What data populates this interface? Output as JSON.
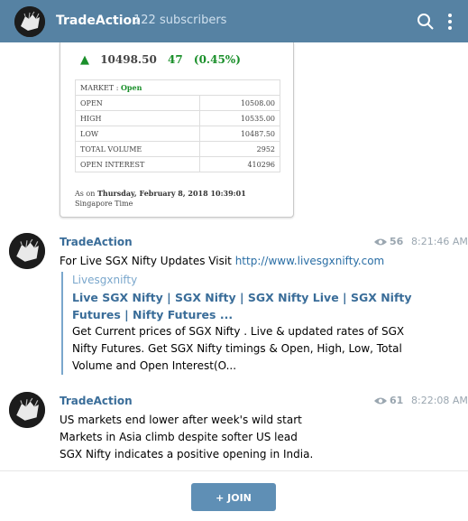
{
  "header": {
    "channel_name": "TradeAction",
    "subscribers": "122 subscribers",
    "icons": {
      "search": "search-icon",
      "menu": "more-vertical-icon"
    }
  },
  "widget": {
    "price": "10498.50",
    "change": "47",
    "change_pct": "(0.45%)",
    "market_label": "MARKET : ",
    "market_state": "Open",
    "rows": [
      {
        "label": "OPEN",
        "value": "10508.00"
      },
      {
        "label": "HIGH",
        "value": "10535.00"
      },
      {
        "label": "LOW",
        "value": "10487.50"
      },
      {
        "label": "TOTAL VOLUME",
        "value": "2952"
      },
      {
        "label": "OPEN INTEREST",
        "value": "410296"
      }
    ],
    "asof_prefix": "As on ",
    "asof_date": "Thursday, February 8, 2018 10:39:01",
    "asof_suffix": " Singapore Time",
    "colors": {
      "up": "#1a8f2a"
    }
  },
  "messages": [
    {
      "author": "TradeAction",
      "views": "56",
      "time": "8:21:46 AM",
      "text_prefix": "For Live SGX Nifty Updates Visit ",
      "link": "http://www.livesgxnifty.com",
      "preview": {
        "site": "Livesgxnifty",
        "title": "Live SGX Nifty | SGX Nifty | SGX Nifty Live | SGX Nifty Futures | Nifty Futures ...",
        "description": "Get Current prices of SGX Nifty . Live & updated rates of SGX Nifty Futures. Get SGX Nifty timings & Open, High, Low, Total Volume and Open Interest(O..."
      }
    },
    {
      "author": "TradeAction",
      "views": "61",
      "time": "8:22:08 AM",
      "lines": [
        "US markets end lower after week's wild start",
        "Markets in Asia climb despite softer US lead",
        "SGX Nifty indicates a positive opening in India."
      ]
    }
  ],
  "join": {
    "label": "+ JOIN"
  },
  "colors": {
    "header_bg": "#5682a3",
    "accent": "#3a6d99",
    "join_bg": "#5f8fb5"
  }
}
